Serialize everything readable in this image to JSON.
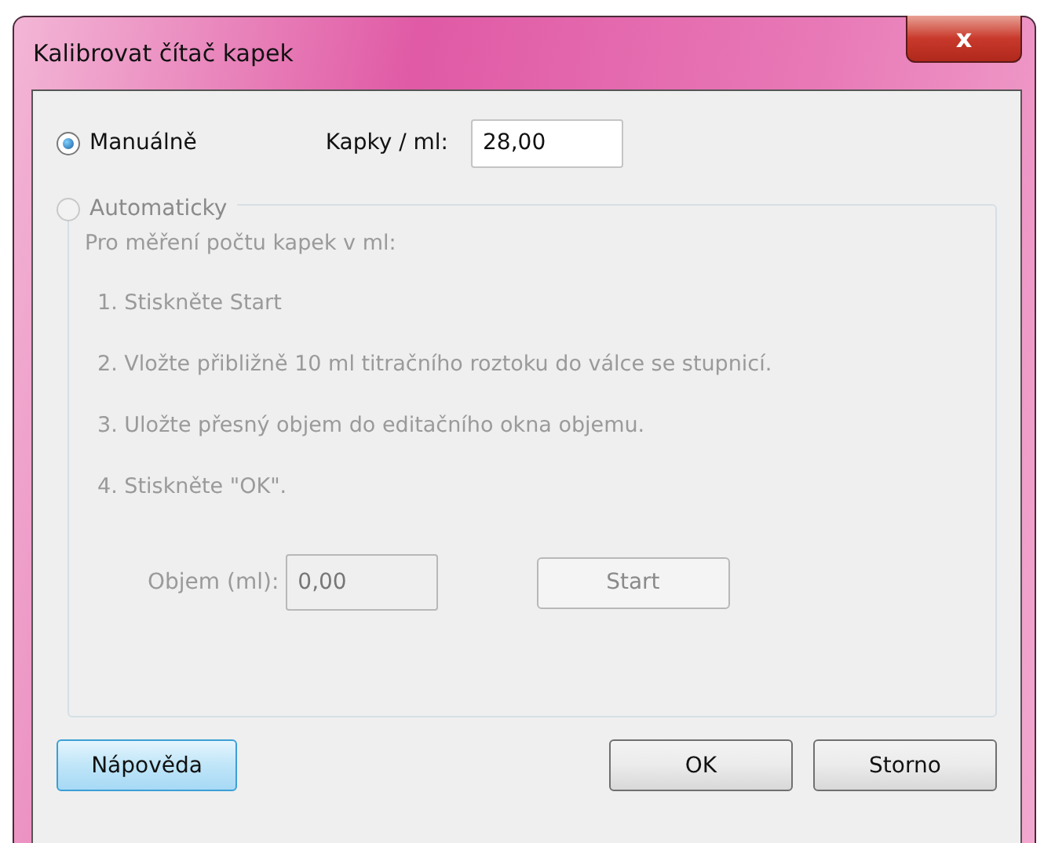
{
  "window": {
    "title": "Kalibrovat čítač kapek",
    "close_button": "x"
  },
  "modes": [
    {
      "label": "Manuálně",
      "selected": true
    },
    {
      "label": "Automaticky",
      "selected": false
    }
  ],
  "manual": {
    "label": "Kapky / ml:",
    "value": "28,00"
  },
  "automatic": {
    "disabled": true,
    "intro": "Pro měření počtu kapek v ml:",
    "steps": [
      "1. Stiskněte Start",
      "2. Vložte přibližně 10 ml titračního roztoku do válce se stupnicí.",
      "3. Uložte přesný objem do editačního okna objemu.",
      "4. Stiskněte \"OK\"."
    ],
    "volume_label": "Objem (ml):",
    "volume_value": "0,00",
    "start_button": "Start"
  },
  "buttons": [
    {
      "label": "Nápověda",
      "focused": true
    },
    {
      "label": "OK",
      "focused": false
    },
    {
      "label": "Storno",
      "focused": false
    }
  ]
}
